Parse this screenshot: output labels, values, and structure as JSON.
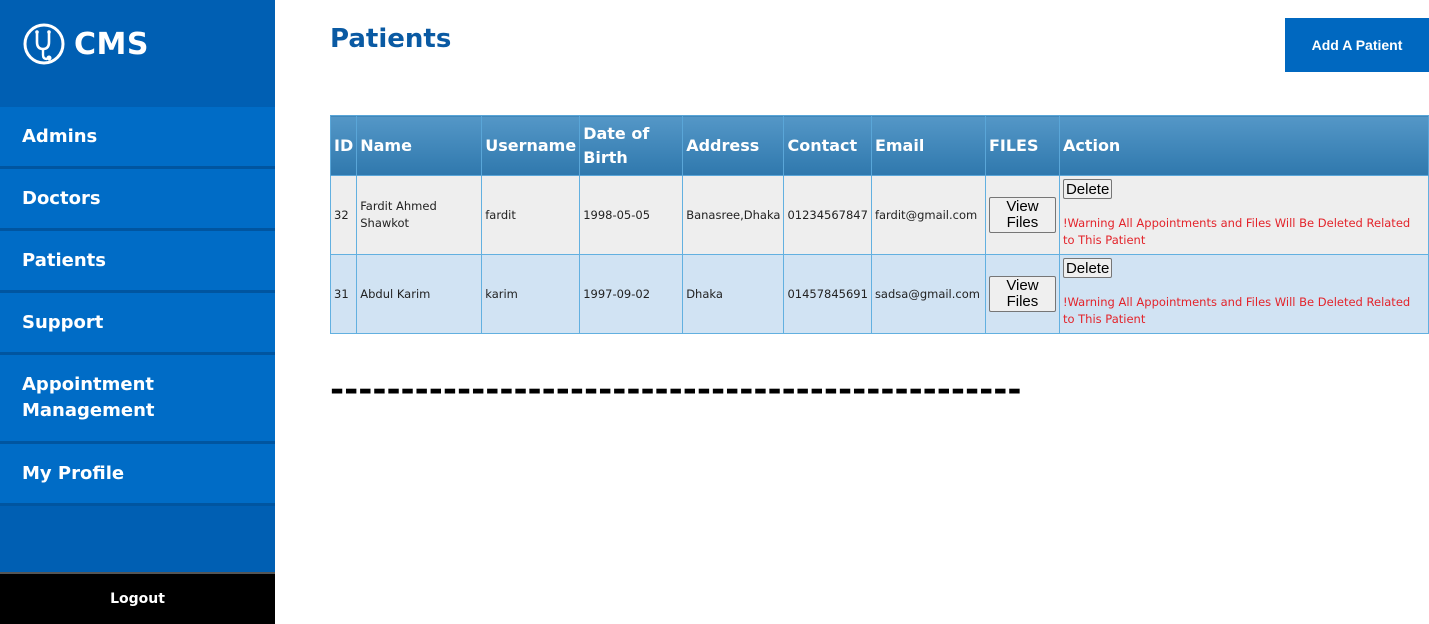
{
  "brand": {
    "name": "CMS",
    "icon": "stethoscope-icon"
  },
  "sidebar": {
    "items": [
      {
        "label": "Admins"
      },
      {
        "label": "Doctors"
      },
      {
        "label": "Patients"
      },
      {
        "label": "Support"
      },
      {
        "label": "Appointment Management"
      },
      {
        "label": "My Profile"
      }
    ],
    "logout_label": "Logout"
  },
  "main": {
    "title": "Patients",
    "add_button_label": "Add A Patient",
    "divider_text": "-------------------------------------------------"
  },
  "table": {
    "columns": [
      "ID",
      "Name",
      "Username",
      "Date of Birth",
      "Address",
      "Contact",
      "Email",
      "FILES",
      "Action"
    ],
    "rows": [
      {
        "id": "32",
        "name": "Fardit Ahmed Shawkot",
        "username": "fardit",
        "dob": "1998-05-05",
        "address": "Banasree,Dhaka",
        "contact": "01234567847",
        "email": "fardit@gmail.com",
        "files_button": "View Files",
        "delete_button": "Delete",
        "warning": "!Warning All Appointments and Files Will Be Deleted Related to This Patient"
      },
      {
        "id": "31",
        "name": "Abdul Karim",
        "username": "karim",
        "dob": "1997-09-02",
        "address": "Dhaka",
        "contact": "01457845691",
        "email": "sadsa@gmail.com",
        "files_button": "View Files",
        "delete_button": "Delete",
        "warning": "!Warning All Appointments and Files Will Be Deleted Related to This Patient"
      }
    ]
  },
  "colors": {
    "sidebar_bg": "#005fb3",
    "nav_item_bg": "#006cc6",
    "title": "#0a5aa3",
    "button_bg": "#0068c0",
    "warning": "#e3242b"
  }
}
